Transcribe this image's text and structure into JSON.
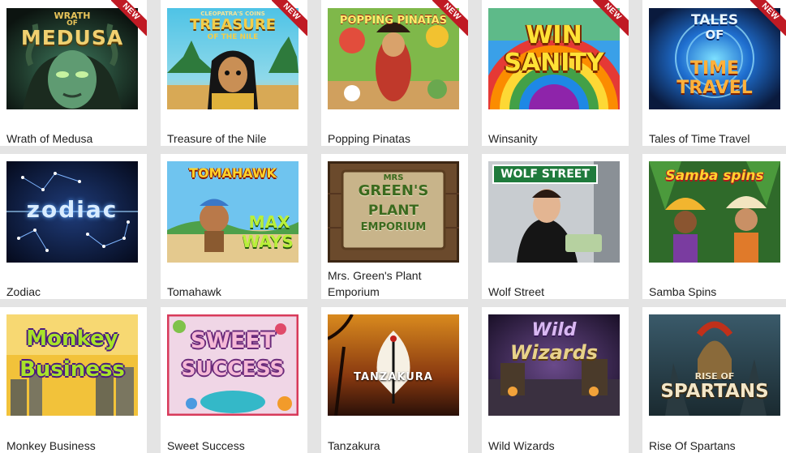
{
  "badge_label": "NEW",
  "games": [
    {
      "title": "Wrath of Medusa",
      "logo_lines": [
        "WRATH",
        "OF",
        "MEDUSA"
      ],
      "is_new": true,
      "icon": "medusa-thumbnail-icon"
    },
    {
      "title": "Treasure of the Nile",
      "logo_lines": [
        "CLEOPATRA'S COINS",
        "TREASURE",
        "OF THE NILE"
      ],
      "is_new": true,
      "icon": "cleopatra-thumbnail-icon"
    },
    {
      "title": "Popping Pinatas",
      "logo_lines": [
        "POPPING PINATAS"
      ],
      "is_new": true,
      "icon": "pinata-thumbnail-icon"
    },
    {
      "title": "Winsanity",
      "logo_lines": [
        "WIN",
        "SANITY"
      ],
      "is_new": true,
      "icon": "rainbow-thumbnail-icon"
    },
    {
      "title": "Tales of Time Travel",
      "logo_lines": [
        "TALES",
        "OF",
        "TIME",
        "TRAVEL"
      ],
      "is_new": true,
      "icon": "time-portal-thumbnail-icon"
    },
    {
      "title": "Zodiac",
      "logo_lines": [
        "zodiac"
      ],
      "is_new": false,
      "icon": "constellation-thumbnail-icon"
    },
    {
      "title": "Tomahawk",
      "logo_lines": [
        "TOMAHAWK",
        "MAX",
        "WAYS"
      ],
      "is_new": false,
      "icon": "warrior-thumbnail-icon"
    },
    {
      "title": "Mrs. Green's Plant Emporium",
      "logo_lines": [
        "MRS",
        "GREEN'S",
        "PLANT",
        "EMPORIUM"
      ],
      "is_new": false,
      "icon": "wooden-sign-thumbnail-icon"
    },
    {
      "title": "Wolf Street",
      "logo_lines": [
        "WOLF STREET"
      ],
      "is_new": false,
      "icon": "street-sign-thumbnail-icon"
    },
    {
      "title": "Samba Spins",
      "logo_lines": [
        "Samba spins"
      ],
      "is_new": false,
      "icon": "dancer-thumbnail-icon"
    },
    {
      "title": "Monkey Business",
      "logo_lines": [
        "Monkey",
        "Business"
      ],
      "is_new": false,
      "icon": "city-skyline-thumbnail-icon"
    },
    {
      "title": "Sweet Success",
      "logo_lines": [
        "SWEET",
        "SUCCESS"
      ],
      "is_new": false,
      "icon": "candy-thumbnail-icon"
    },
    {
      "title": "Tanzakura",
      "logo_lines": [
        "TANZAKURA"
      ],
      "is_new": false,
      "icon": "crane-thumbnail-icon"
    },
    {
      "title": "Wild Wizards",
      "logo_lines": [
        "Wild",
        "Wizards"
      ],
      "is_new": false,
      "icon": "wizard-thumbnail-icon"
    },
    {
      "title": "Rise Of Spartans",
      "logo_lines": [
        "RISE OF",
        "SPARTANS"
      ],
      "is_new": false,
      "icon": "spartan-thumbnail-icon"
    }
  ],
  "colors": {
    "page_background": "#e4e4e4",
    "card_background": "#ffffff",
    "badge": "#c01a24",
    "title_text": "#222222"
  }
}
